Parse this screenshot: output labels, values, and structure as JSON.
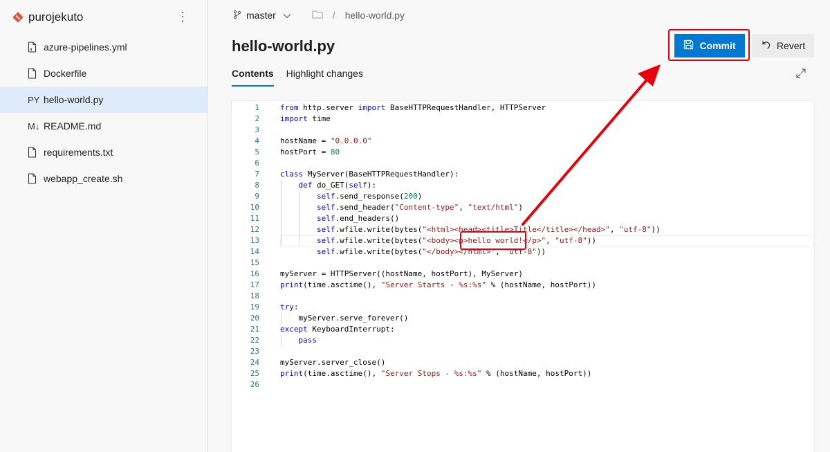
{
  "repo": {
    "name": "purojekuto"
  },
  "sidebar": {
    "files": [
      {
        "label": "azure-pipelines.yml",
        "icon": "yaml-file-icon",
        "glyph": ""
      },
      {
        "label": "Dockerfile",
        "icon": "file-icon",
        "glyph": ""
      },
      {
        "label": "hello-world.py",
        "icon": "python-file-icon",
        "glyph": "PY",
        "selected": true
      },
      {
        "label": "README.md",
        "icon": "markdown-file-icon",
        "glyph": "M↓"
      },
      {
        "label": "requirements.txt",
        "icon": "file-icon",
        "glyph": ""
      },
      {
        "label": "webapp_create.sh",
        "icon": "file-icon",
        "glyph": ""
      }
    ]
  },
  "breadcrumb": {
    "branch": "master",
    "separator": "/",
    "file": "hello-world.py"
  },
  "page": {
    "title": "hello-world.py"
  },
  "toolbar": {
    "commit_label": "Commit",
    "revert_label": "Revert"
  },
  "tabs": [
    {
      "label": "Contents",
      "active": true
    },
    {
      "label": "Highlight changes",
      "active": false
    }
  ],
  "editor": {
    "current_line": 13,
    "lines": [
      [
        [
          "kw",
          "from"
        ],
        [
          "t",
          " http.server "
        ],
        [
          "kw",
          "import"
        ],
        [
          "t",
          " BaseHTTPRequestHandler, HTTPServer"
        ]
      ],
      [
        [
          "kw",
          "import"
        ],
        [
          "t",
          " time"
        ]
      ],
      [],
      [
        [
          "t",
          "hostName = "
        ],
        [
          "str",
          "\"0.0.0.0\""
        ]
      ],
      [
        [
          "t",
          "hostPort = "
        ],
        [
          "num",
          "80"
        ]
      ],
      [],
      [
        [
          "kw",
          "class"
        ],
        [
          "t",
          " MyServer(BaseHTTPRequestHandler):"
        ]
      ],
      [
        [
          "t",
          "    "
        ],
        [
          "kw",
          "def"
        ],
        [
          "t",
          " do_GET("
        ],
        [
          "kw",
          "self"
        ],
        [
          "t",
          "):"
        ]
      ],
      [
        [
          "t",
          "        "
        ],
        [
          "kw",
          "self"
        ],
        [
          "t",
          ".send_response("
        ],
        [
          "num",
          "200"
        ],
        [
          "t",
          ")"
        ]
      ],
      [
        [
          "t",
          "        "
        ],
        [
          "kw",
          "self"
        ],
        [
          "t",
          ".send_header("
        ],
        [
          "str",
          "\"Content-type\""
        ],
        [
          "t",
          ", "
        ],
        [
          "str",
          "\"text/html\""
        ],
        [
          "t",
          ")"
        ]
      ],
      [
        [
          "t",
          "        "
        ],
        [
          "kw",
          "self"
        ],
        [
          "t",
          ".end_headers()"
        ]
      ],
      [
        [
          "t",
          "        "
        ],
        [
          "kw",
          "self"
        ],
        [
          "t",
          ".wfile.write(bytes("
        ],
        [
          "str",
          "\"<html><head><title>Title</title></head>\""
        ],
        [
          "t",
          ", "
        ],
        [
          "str",
          "\"utf-8\""
        ],
        [
          "t",
          "))"
        ]
      ],
      [
        [
          "t",
          "        "
        ],
        [
          "kw",
          "self"
        ],
        [
          "t",
          ".wfile.write(bytes("
        ],
        [
          "str",
          "\"<body><p>hello world!</p>\""
        ],
        [
          "t",
          ", "
        ],
        [
          "str",
          "\"utf-8\""
        ],
        [
          "t",
          "))"
        ]
      ],
      [
        [
          "t",
          "        "
        ],
        [
          "kw",
          "self"
        ],
        [
          "t",
          ".wfile.write(bytes("
        ],
        [
          "str",
          "\"</body></html>\""
        ],
        [
          "t",
          ", "
        ],
        [
          "str",
          "\"utf-8\""
        ],
        [
          "t",
          "))"
        ]
      ],
      [],
      [
        [
          "t",
          "myServer = HTTPServer((hostName, hostPort), MyServer)"
        ]
      ],
      [
        [
          "kw",
          "print"
        ],
        [
          "t",
          "(time.asctime(), "
        ],
        [
          "str",
          "\"Server Starts - %s:%s\""
        ],
        [
          "t",
          " % (hostName, hostPort))"
        ]
      ],
      [],
      [
        [
          "kw",
          "try"
        ],
        [
          "t",
          ":"
        ]
      ],
      [
        [
          "t",
          "    myServer.serve_forever()"
        ]
      ],
      [
        [
          "kw",
          "except"
        ],
        [
          "t",
          " KeyboardInterrupt:"
        ]
      ],
      [
        [
          "t",
          "    "
        ],
        [
          "kw",
          "pass"
        ]
      ],
      [],
      [
        [
          "t",
          "myServer.server_close()"
        ]
      ],
      [
        [
          "kw",
          "print"
        ],
        [
          "t",
          "(time.asctime(), "
        ],
        [
          "str",
          "\"Server Stops - %s:%s\""
        ],
        [
          "t",
          " % (hostName, hostPort))"
        ]
      ],
      []
    ]
  },
  "annotation": {
    "color": "#e8000b"
  }
}
